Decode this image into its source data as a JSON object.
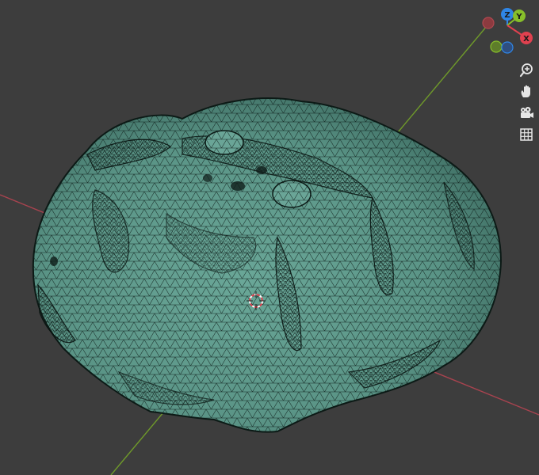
{
  "viewport": {
    "background_color": "#3d3d3d",
    "x_axis_color": "#a8434f",
    "y_axis_color": "#6f9a2a",
    "mesh_fill_color": "#5e9a8c",
    "mesh_wire_color": "#0c1a16"
  },
  "gizmo": {
    "x_label": "X",
    "y_label": "Y",
    "z_label": "Z",
    "x_color": "#e0414f",
    "y_color": "#87bf2a",
    "z_color": "#2f86e6",
    "neg_x_color": "#8c3a3f",
    "neg_y_color": "#5e7d2a",
    "neg_z_color": "#2f4f80"
  },
  "nav_buttons": [
    {
      "icon": "zoom-icon"
    },
    {
      "icon": "hand-pan-icon"
    },
    {
      "icon": "camera-icon"
    },
    {
      "icon": "perspective-grid-icon"
    }
  ],
  "cursor_3d": {
    "icon": "3d-cursor-icon"
  }
}
